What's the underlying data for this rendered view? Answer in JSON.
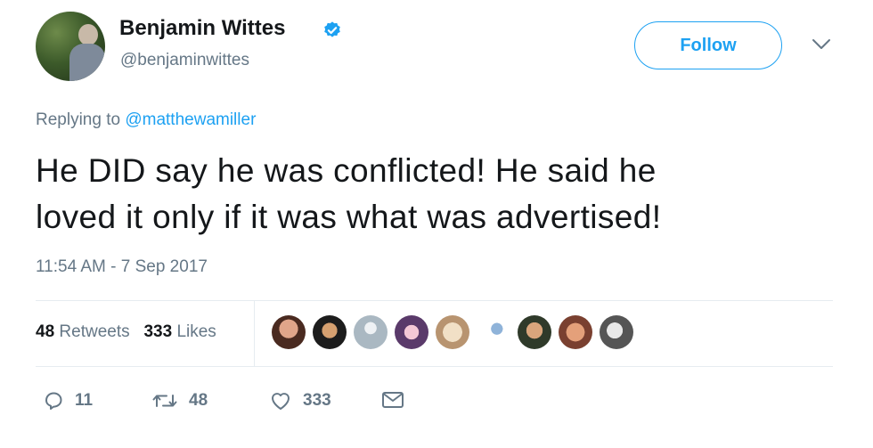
{
  "author": {
    "display_name": "Benjamin Wittes",
    "handle": "@benjaminwittes",
    "verified": true
  },
  "follow_label": "Follow",
  "reply_context": {
    "prefix": "Replying to",
    "mention": "@matthewamiller"
  },
  "tweet": {
    "line1": "He DID say he was conflicted! He said he",
    "line2": "loved it only if it was what was advertised!",
    "timestamp": "11:54 AM - 7 Sep 2017"
  },
  "stats": {
    "retweets_count": "48",
    "retweets_label": "Retweets",
    "likes_count": "333",
    "likes_label": "Likes"
  },
  "actions": {
    "reply_count": "11",
    "retweet_count": "48",
    "like_count": "333"
  },
  "icons": [
    "verified-badge-icon",
    "chevron-down-icon",
    "reply-icon",
    "retweet-icon",
    "heart-icon",
    "direct-message-icon"
  ],
  "colors": {
    "accent": "#1da1f2",
    "secondary_text": "#657786",
    "primary_text": "#14171a",
    "divider": "#e6ecf0"
  }
}
